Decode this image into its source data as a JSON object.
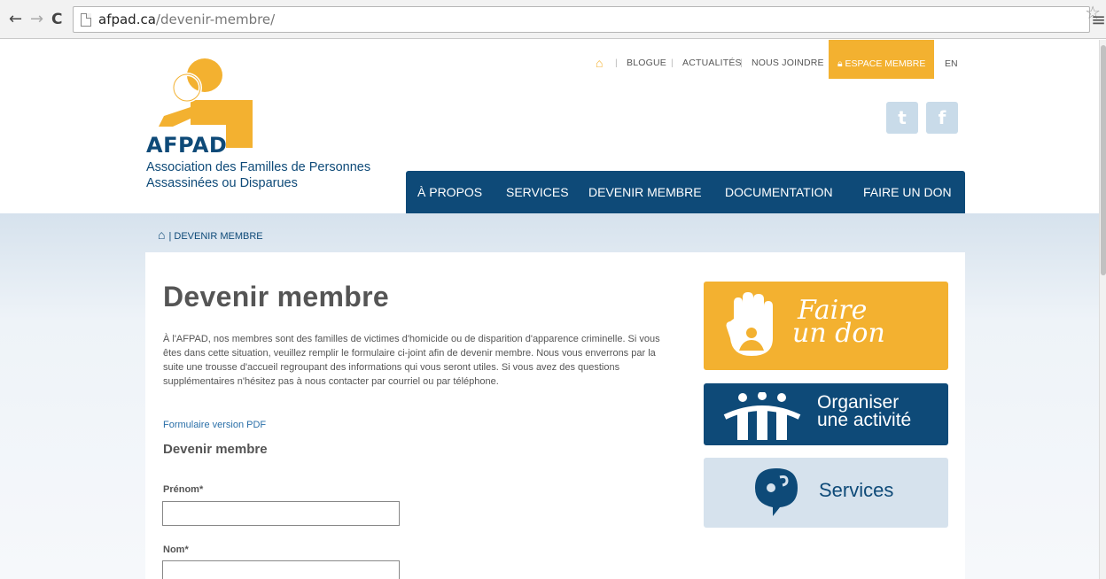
{
  "browser": {
    "url_host": "afpad.ca",
    "url_path": "/devenir-membre/"
  },
  "logo": {
    "text": "AFPAD",
    "org_line1": "Association des Familles de Personnes",
    "org_line2": "Assassinées ou Disparues"
  },
  "topnav": {
    "items": [
      "BLOGUE",
      "ACTUALITÉS",
      "NOUS JOINDRE"
    ],
    "espace": "ESPACE MEMBRE",
    "lang": "EN"
  },
  "social": [
    "twitter-icon",
    "facebook-icon"
  ],
  "mainnav": [
    "À PROPOS",
    "SERVICES",
    "DEVENIR MEMBRE",
    "DOCUMENTATION",
    "FAIRE UN DON"
  ],
  "breadcrumb": "DEVENIR MEMBRE",
  "main": {
    "title": "Devenir membre",
    "intro": "À l'AFPAD, nos membres sont des familles de victimes d'homicide ou de disparition d'apparence criminelle. Si vous êtes dans cette situation, veuillez remplir le formulaire ci-joint afin de devenir membre. Nous vous enverrons par la suite une trousse d'accueil regroupant des informations qui vous seront utiles. Si vous avez des questions supplémentaires n'hésitez pas à nous contacter par courriel ou par téléphone.",
    "pdf_link": "Formulaire version PDF",
    "form_title": "Devenir membre",
    "fields": [
      "Prénom*",
      "Nom*"
    ]
  },
  "tiles": {
    "don_line1": "Faire",
    "don_line2": "un don",
    "act_line1": "Organiser",
    "act_line2": "une activité",
    "services": "Services"
  },
  "colors": {
    "brand_blue": "#0e4a78",
    "brand_orange": "#f3b130",
    "light_blue": "#d6e2ed"
  }
}
